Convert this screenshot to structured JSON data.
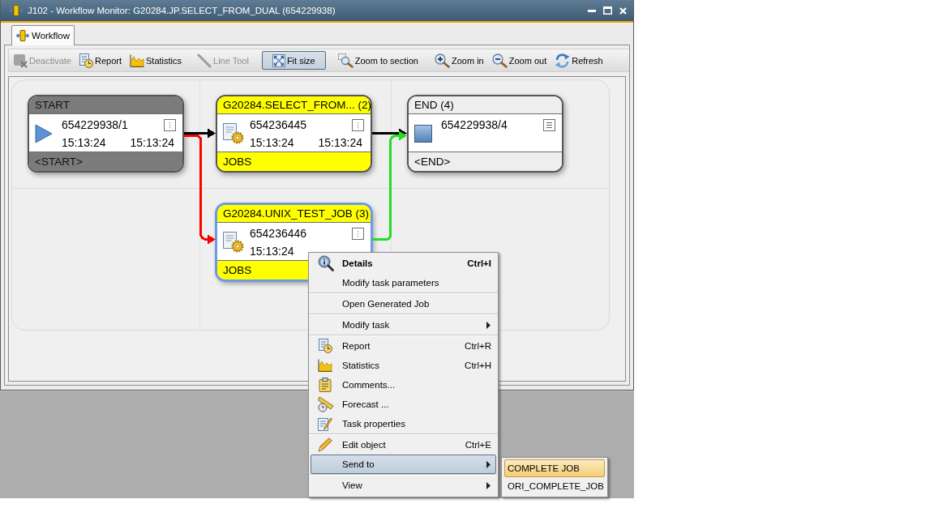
{
  "window": {
    "title": "J102 - Workflow Monitor: G20284.JP.SELECT_FROM_DUAL (654229938)"
  },
  "tabs": [
    {
      "label": "Workflow",
      "selected": true
    }
  ],
  "toolbar": [
    {
      "label": "Deactivate",
      "disabled": true,
      "selected": false
    },
    {
      "label": "Report",
      "disabled": false,
      "selected": false
    },
    {
      "label": "Statistics",
      "disabled": false,
      "selected": false
    },
    {
      "label": "Line Tool",
      "disabled": true,
      "selected": false
    },
    {
      "label": "Fit size",
      "disabled": false,
      "selected": true
    },
    {
      "label": "Zoom to section",
      "disabled": false,
      "selected": false
    },
    {
      "label": "Zoom in",
      "disabled": false,
      "selected": false
    },
    {
      "label": "Zoom out",
      "disabled": false,
      "selected": false
    },
    {
      "label": "Refresh",
      "disabled": false,
      "selected": false
    }
  ],
  "workflow": {
    "columns": [
      {
        "nodes": [
          {
            "kind": "start",
            "title": "START",
            "number": "654229938/1",
            "start_time": "15:13:24",
            "end_time": "15:13:24",
            "footer": "<START>",
            "selected": false,
            "outgoing": [
              {
                "color": "#000000"
              },
              {
                "color": "#ff0000"
              }
            ]
          }
        ]
      },
      {
        "nodes": [
          {
            "kind": "job",
            "title": "G20284.SELECT_FROM... (2)",
            "number": "654236445",
            "start_time": "15:13:24",
            "end_time": "15:13:24",
            "footer": "JOBS",
            "selected": false,
            "outgoing": [
              {
                "color": "#000000"
              }
            ]
          },
          {
            "kind": "job",
            "title": "G20284.UNIX_TEST_JOB (3)",
            "number": "654236446",
            "start_time": "15:13:24",
            "footer": "JOBS",
            "selected": true,
            "outgoing": [
              {
                "color": "#22dd22"
              }
            ]
          }
        ]
      },
      {
        "nodes": [
          {
            "kind": "end",
            "title": "END (4)",
            "number": "654229938/4",
            "footer": "<END>",
            "selected": false
          }
        ]
      }
    ]
  },
  "context_menu": {
    "sections": [
      {
        "items": [
          {
            "label": "Details",
            "shortcut": "Ctrl+I",
            "default": true,
            "submenu": false,
            "selected": false
          },
          {
            "label": "Modify task parameters",
            "default": false,
            "submenu": false,
            "selected": false
          }
        ]
      },
      {
        "items": [
          {
            "label": "Open Generated Job",
            "default": false,
            "submenu": false,
            "selected": false
          }
        ]
      },
      {
        "items": [
          {
            "label": "Modify task",
            "default": false,
            "submenu": true,
            "selected": false
          }
        ]
      },
      {
        "items": [
          {
            "label": "Report",
            "shortcut": "Ctrl+R",
            "default": false,
            "submenu": false,
            "selected": false
          },
          {
            "label": "Statistics",
            "shortcut": "Ctrl+H",
            "default": false,
            "submenu": false,
            "selected": false
          },
          {
            "label": "Comments...",
            "default": false,
            "submenu": false,
            "selected": false
          },
          {
            "label": "Forecast ...",
            "default": false,
            "submenu": false,
            "selected": false
          },
          {
            "label": "Task properties",
            "default": false,
            "submenu": false,
            "selected": false
          }
        ]
      },
      {
        "items": [
          {
            "label": "Edit object",
            "shortcut": "Ctrl+E",
            "default": false,
            "submenu": false,
            "selected": false
          },
          {
            "label": "Send to",
            "default": false,
            "submenu": true,
            "selected": true
          }
        ]
      },
      {
        "items": [
          {
            "label": "View",
            "default": false,
            "submenu": true,
            "selected": false
          }
        ]
      }
    ]
  },
  "submenu": {
    "items": [
      {
        "label": "COMPLETE JOB",
        "selected": true
      },
      {
        "label": "ORI_COMPLETE_JOB",
        "selected": false
      }
    ]
  }
}
